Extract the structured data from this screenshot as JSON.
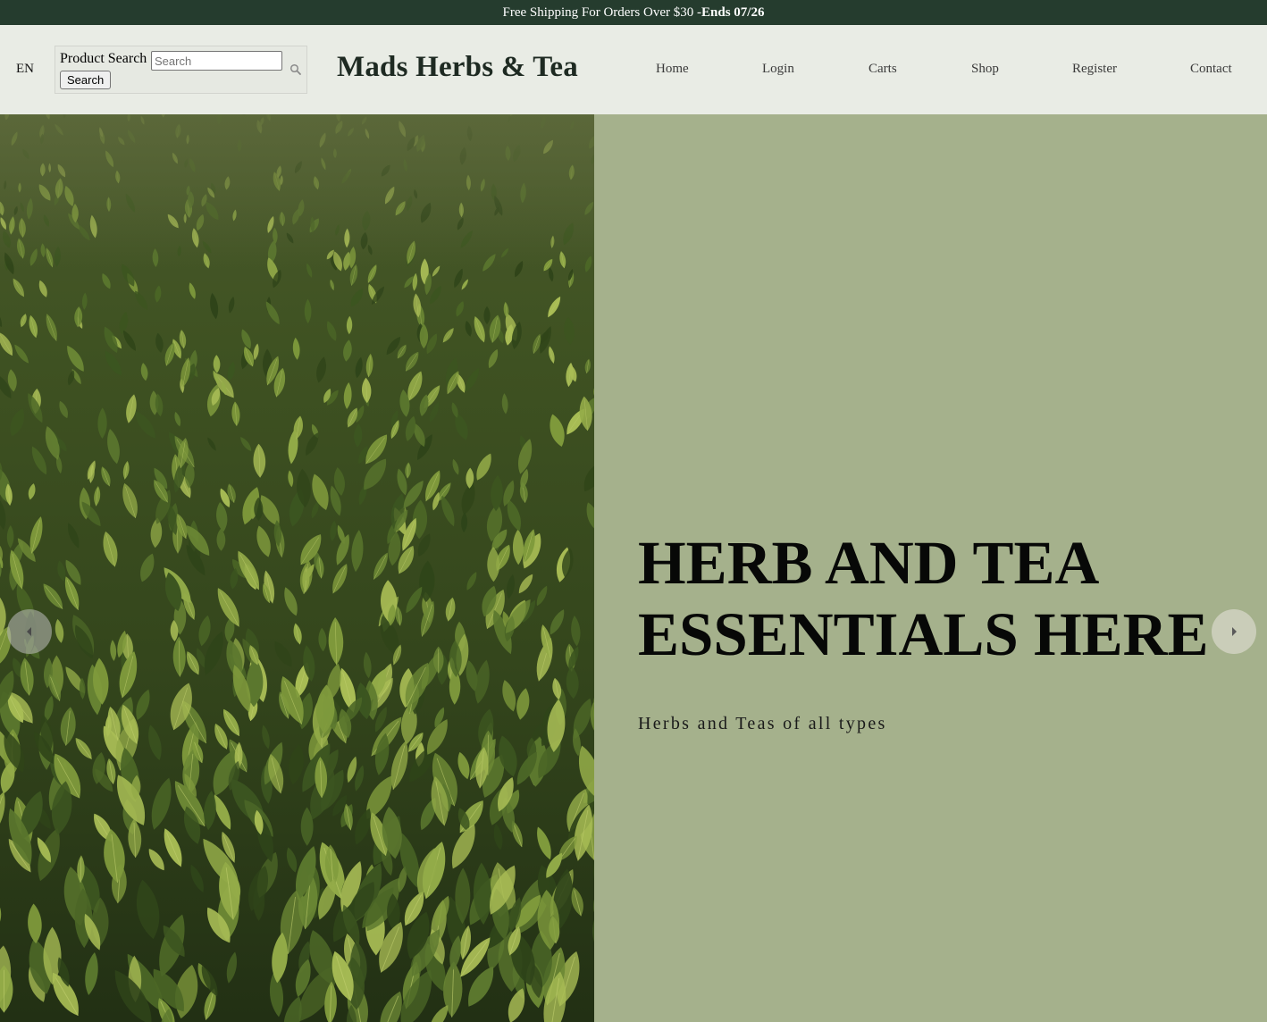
{
  "announcement": {
    "text": "Free Shipping For Orders Over $30 -",
    "highlight": "Ends 07/26"
  },
  "header": {
    "language": "EN",
    "search": {
      "label": "Product Search",
      "placeholder": "Search",
      "value": "",
      "button_label": "Search"
    },
    "logo": "Mads Herbs & Tea",
    "nav": [
      "Home",
      "Login",
      "Carts",
      "Shop",
      "Register",
      "Contact"
    ]
  },
  "hero": {
    "title_line1": "HERB AND TEA",
    "title_line2": "ESSENTIALS HERE",
    "subtitle": "Herbs and Teas of all types",
    "image": "tea-field-photo",
    "prev_icon": "chevron-left-icon",
    "next_icon": "chevron-right-icon"
  },
  "colors": {
    "announcement_bg": "#253c2e",
    "header_bg": "#e9ece5",
    "hero_panel_bg": "#a5b18c"
  }
}
